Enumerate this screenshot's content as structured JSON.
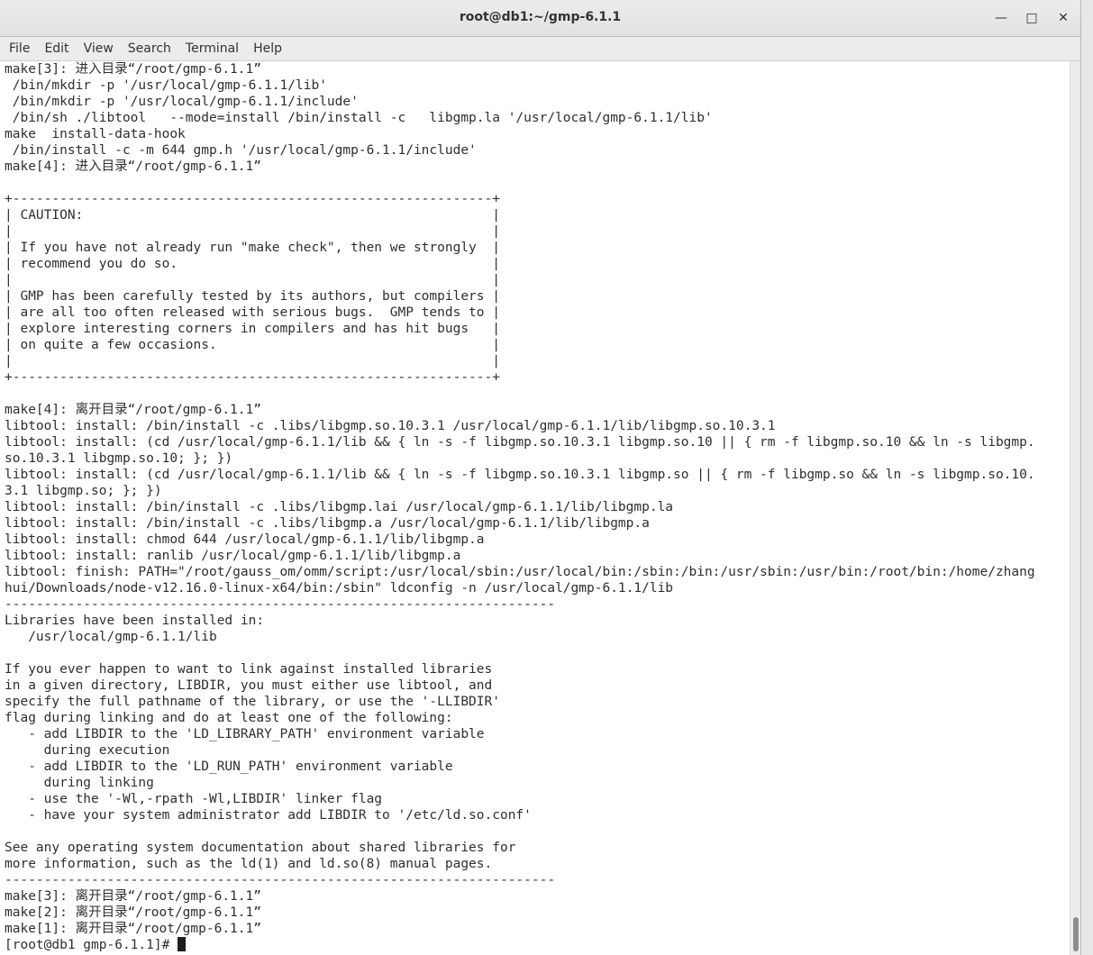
{
  "window": {
    "title": "root@db1:~/gmp-6.1.1",
    "minimize_glyph": "—",
    "maximize_glyph": "□",
    "close_glyph": "✕"
  },
  "menu": [
    "File",
    "Edit",
    "View",
    "Search",
    "Terminal",
    "Help"
  ],
  "terminal": {
    "lines": [
      "make[3]: 进入目录“/root/gmp-6.1.1”",
      " /bin/mkdir -p '/usr/local/gmp-6.1.1/lib'",
      " /bin/mkdir -p '/usr/local/gmp-6.1.1/include'",
      " /bin/sh ./libtool   --mode=install /bin/install -c   libgmp.la '/usr/local/gmp-6.1.1/lib'",
      "make  install-data-hook",
      " /bin/install -c -m 644 gmp.h '/usr/local/gmp-6.1.1/include'",
      "make[4]: 进入目录“/root/gmp-6.1.1”",
      "",
      "+-------------------------------------------------------------+",
      "| CAUTION:                                                    |",
      "|                                                             |",
      "| If you have not already run \"make check\", then we strongly  |",
      "| recommend you do so.                                        |",
      "|                                                             |",
      "| GMP has been carefully tested by its authors, but compilers |",
      "| are all too often released with serious bugs.  GMP tends to |",
      "| explore interesting corners in compilers and has hit bugs   |",
      "| on quite a few occasions.                                   |",
      "|                                                             |",
      "+-------------------------------------------------------------+",
      "",
      "make[4]: 离开目录“/root/gmp-6.1.1”",
      "libtool: install: /bin/install -c .libs/libgmp.so.10.3.1 /usr/local/gmp-6.1.1/lib/libgmp.so.10.3.1",
      "libtool: install: (cd /usr/local/gmp-6.1.1/lib && { ln -s -f libgmp.so.10.3.1 libgmp.so.10 || { rm -f libgmp.so.10 && ln -s libgmp.",
      "so.10.3.1 libgmp.so.10; }; })",
      "libtool: install: (cd /usr/local/gmp-6.1.1/lib && { ln -s -f libgmp.so.10.3.1 libgmp.so || { rm -f libgmp.so && ln -s libgmp.so.10.",
      "3.1 libgmp.so; }; })",
      "libtool: install: /bin/install -c .libs/libgmp.lai /usr/local/gmp-6.1.1/lib/libgmp.la",
      "libtool: install: /bin/install -c .libs/libgmp.a /usr/local/gmp-6.1.1/lib/libgmp.a",
      "libtool: install: chmod 644 /usr/local/gmp-6.1.1/lib/libgmp.a",
      "libtool: install: ranlib /usr/local/gmp-6.1.1/lib/libgmp.a",
      "libtool: finish: PATH=\"/root/gauss_om/omm/script:/usr/local/sbin:/usr/local/bin:/sbin:/bin:/usr/sbin:/usr/bin:/root/bin:/home/zhang",
      "hui/Downloads/node-v12.16.0-linux-x64/bin:/sbin\" ldconfig -n /usr/local/gmp-6.1.1/lib",
      "----------------------------------------------------------------------",
      "Libraries have been installed in:",
      "   /usr/local/gmp-6.1.1/lib",
      "",
      "If you ever happen to want to link against installed libraries",
      "in a given directory, LIBDIR, you must either use libtool, and",
      "specify the full pathname of the library, or use the '-LLIBDIR'",
      "flag during linking and do at least one of the following:",
      "   - add LIBDIR to the 'LD_LIBRARY_PATH' environment variable",
      "     during execution",
      "   - add LIBDIR to the 'LD_RUN_PATH' environment variable",
      "     during linking",
      "   - use the '-Wl,-rpath -Wl,LIBDIR' linker flag",
      "   - have your system administrator add LIBDIR to '/etc/ld.so.conf'",
      "",
      "See any operating system documentation about shared libraries for",
      "more information, such as the ld(1) and ld.so(8) manual pages.",
      "----------------------------------------------------------------------",
      "make[3]: 离开目录“/root/gmp-6.1.1”",
      "make[2]: 离开目录“/root/gmp-6.1.1”",
      "make[1]: 离开目录“/root/gmp-6.1.1”"
    ],
    "prompt": "[root@db1 gmp-6.1.1]# "
  }
}
